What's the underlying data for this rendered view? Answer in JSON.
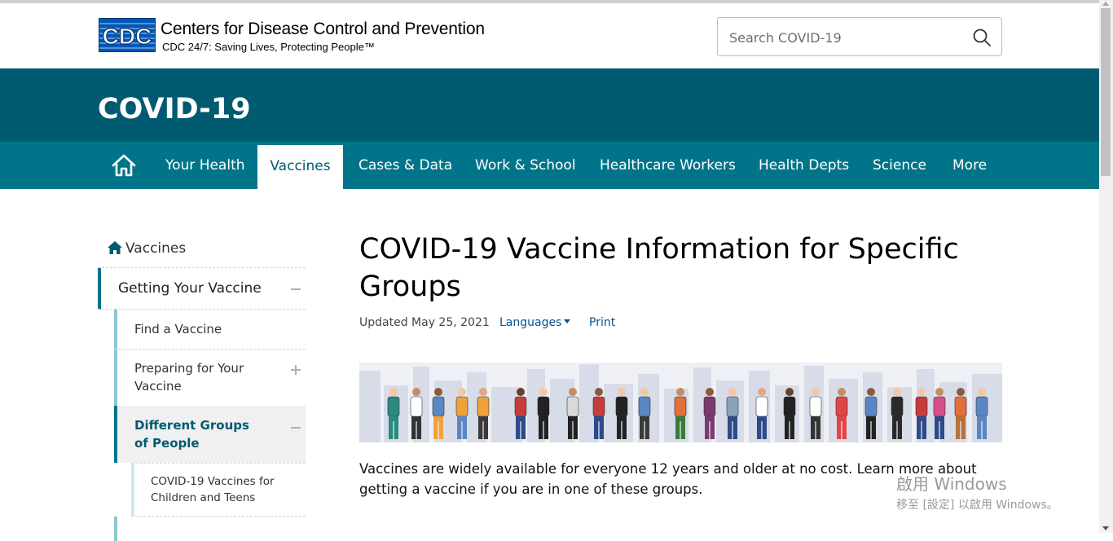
{
  "header": {
    "logo_text": "CDC",
    "org_name": "Centers for Disease Control and Prevention",
    "tagline": "CDC 24/7: Saving Lives, Protecting People™",
    "search_placeholder": "Search COVID-19"
  },
  "site": {
    "title": "COVID-19"
  },
  "nav": {
    "home_icon": "home-icon",
    "items": [
      {
        "label": "Your Health"
      },
      {
        "label": "Vaccines",
        "active": true
      },
      {
        "label": "Cases & Data"
      },
      {
        "label": "Work & School"
      },
      {
        "label": "Healthcare Workers"
      },
      {
        "label": "Health Depts"
      },
      {
        "label": "Science"
      },
      {
        "label": "More"
      }
    ]
  },
  "sidenav": {
    "home_label": "Vaccines",
    "items": [
      {
        "label": "Getting Your Vaccine",
        "level": 1,
        "expanded": true
      },
      {
        "label": "Find a Vaccine",
        "level": 2
      },
      {
        "label": "Preparing for Your Vaccine",
        "level": 2,
        "expandable": true
      },
      {
        "label": "Different Groups of People",
        "level": 2,
        "current": true,
        "expanded": true
      },
      {
        "label": "COVID-19 Vaccines for Children and Teens",
        "level": 3
      }
    ]
  },
  "main": {
    "title": "COVID-19 Vaccine Information for Specific Groups",
    "updated": "Updated May 25, 2021",
    "languages_label": "Languages",
    "print_label": "Print",
    "intro": "Vaccines are widely available for everyone 12 years and older at no cost. Learn more about getting a vaccine if you are in one of these groups."
  },
  "watermark": {
    "line1": "啟用 Windows",
    "line2": "移至 [設定] 以啟用 Windows。"
  },
  "colors": {
    "banner": "#005a70",
    "nav": "#00758a",
    "link": "#075290",
    "logo": "#0057b7"
  }
}
